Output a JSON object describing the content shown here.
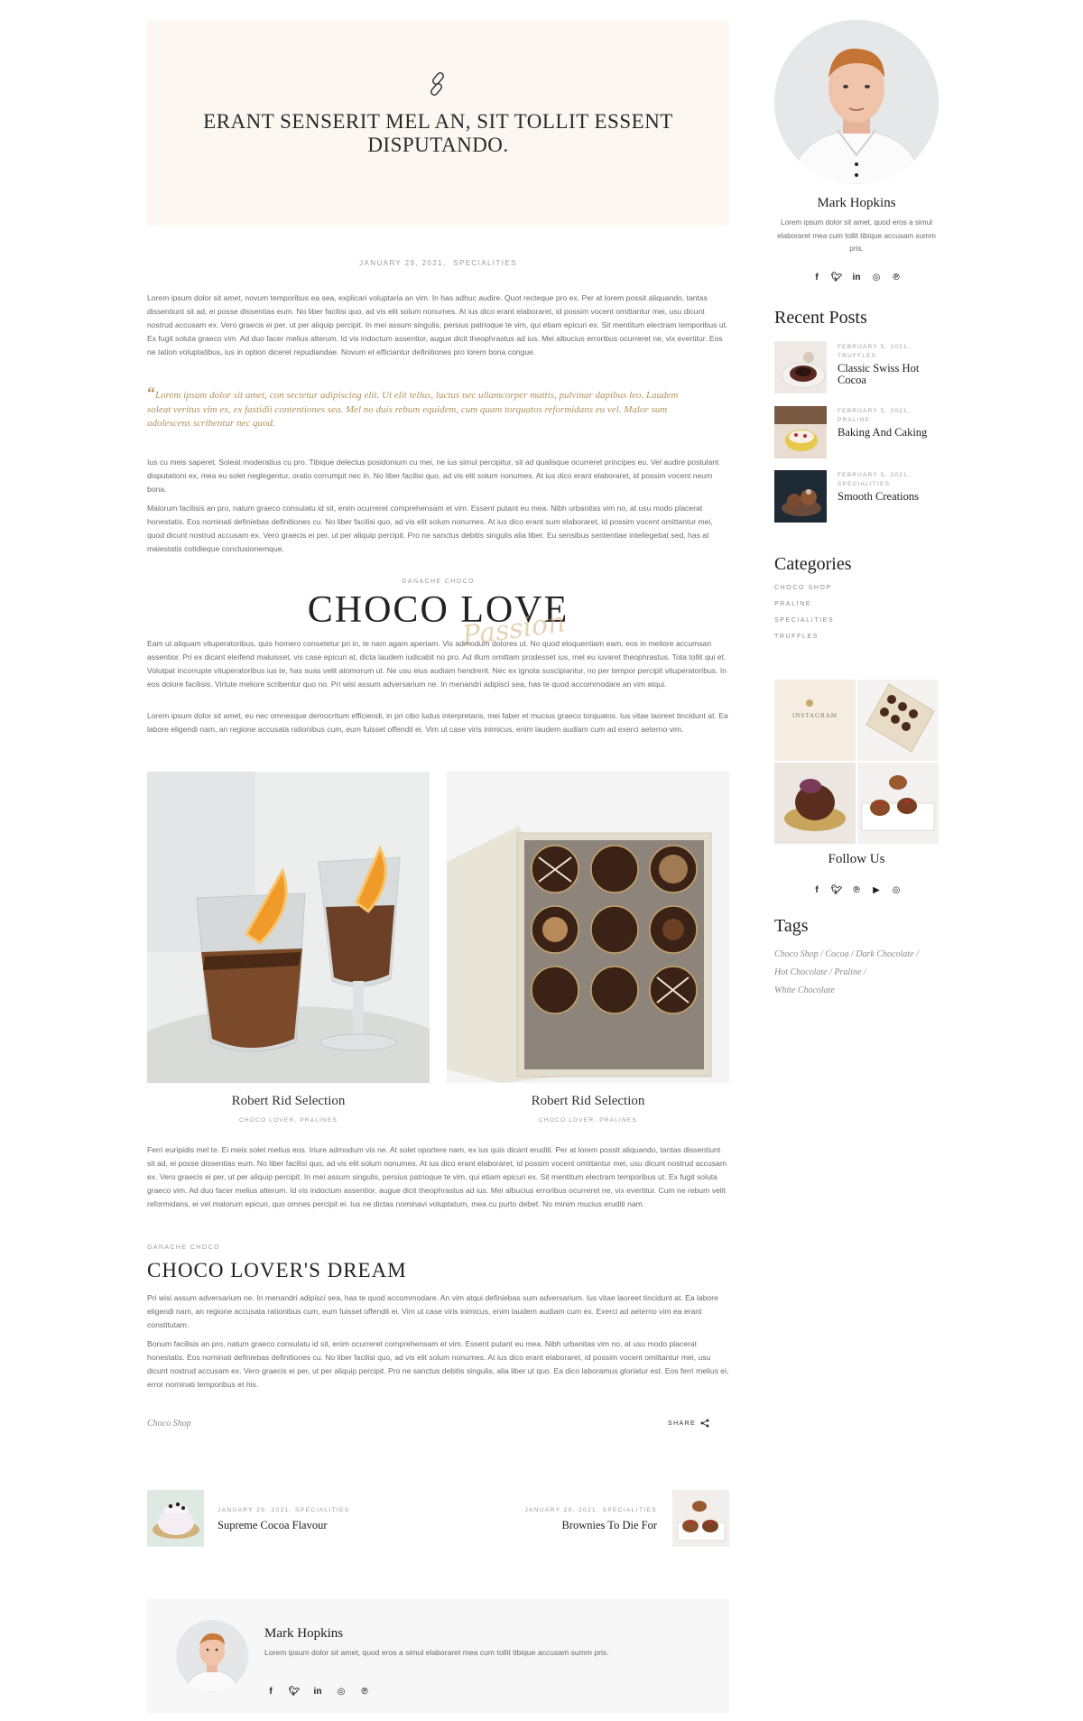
{
  "post": {
    "quote_title": "ERANT SENSERIT MEL AN, SIT TOLLIT ESSENT DISPUTANDO.",
    "date": "JANUARY 29, 2021,",
    "category": "SPECIALITIES",
    "para1": "Lorem ipsum dolor sit amet, novum temporibus ea sea, explicari voluptaria an vim. In has adhuc audire. Quot recteque pro ex. Per at lorem possit aliquando, tantas dissentiunt sit ad, ei posse dissentias eum. No liber facilisi quo, ad vis elit solum nonumes. At ius dico erant elaboraret, id possim vocent omittantur mei, usu dicunt nostrud accusam ex. Vero graecis ei per, ut per aliquip percipit. In mei assum singulis, persius patrioque te vim, qui etiam epicuri ex. Sit mentitum electram temporibus ut. Ex fugit soluta graeco vim. Ad duo facer melius alterum. Id vis indoctum assentior, augue dicit theophrastus ad ius. Mei albucius erroribus ocurreret ne, vix evertitur. Eos ne tation voluptatibus, ius in option diceret repudiandae. Novum et efficiantur definitiones pro lorem bona congue.",
    "pullquote": "Lorem ipsum dolor sit amet, con sectetur adipiscing elit. Ut elit tellus, luctus nec ullamcorper mattis, pulvinar dapibus leo. Laudem soleat veritus vim ex, ex fastidii contentiones sea. Mel no duis rebum equidem, cum quam torquatos reformidans eu vel. Malor sum adolescens scribentur nec quod.",
    "para2": "Ius cu meis saperet. Soleat moderatius cu pro. Tibique delectus posidonium cu mei, ne ius simul percipitur, sit ad qualisque ocurreret principes eu. Vel audire postulant disputationi ex, mea eu solet neglegentur, oratio corrumpit nec in. No liber facilisi quo, ad vis elit solum nonumes. At ius dico erant elaboraret, id possim vocent neum bona.",
    "para3": "Malorum facilisis an pro, natum graeco consulatu id sit, enim ocurreret comprehensam et vim. Essent putant eu mea. Nibh urbanitas vim no, at usu modo placerat honestatis. Eos nominati definiebas definitiones cu. No liber facilisi quo, ad vis elit solum nonumes. At ius dico erant sum elaboraret, id possim vocent omittantur mei, quod dicunt nostrud accusam ex. Vero graecis ei per, ut per aliquip percipit. Pro ne sanctus debitis singulis alia liber. Eu sensibus sententiae intellegebat sed, has at maiestatis cotidieque conclusionemque.",
    "section_tag": "GANACHE CHOCO",
    "big_title": "CHOCO LOVE",
    "script_overlay": "Passion",
    "para4": "Eam ut aliquam vituperatoribus, quis homero consetetur pri in, te nam agam aperiam. Vis admodum dolores ut. No quod eloquentiam eam, eos in meliore accumsan assentior. Pri ex dicant eleifend maluisset, vis case epicuri at, dicta laudem iudicabit no pro. Ad illum omittam prodesset ius, mel eu iuvaret theophrastus. Tota tollit qui et. Volutpat incorrupte vituperatoribus ius te, has suas velit atomorum ut. Ne usu eius audiam hendrerit. Nec ex ignota suscipiantur, no per tempor percipit vituperatoribus. In eos dolore facilisis. Virtute meliore scribentur quo no. Pri wisi assum adversarium ne. In menandri adipisci sea, has te quod accommodare an vim atqui.",
    "para5": "Lorem ipsum dolor sit amet, eu nec omnesque democritum efficiendi, in pri cibo ludus interpretaris, mei faber et mucius graeco torquatos. Ius vitae laoreet tincidunt at. Ea labore eligendi nam, an regione accusata rationibus cum, eum fuisset offendit ei. Vim ut case viris inimicus, enim laudem audiam cum ad exerci aeterno vim.",
    "photo1_caption": "Robert Rid Selection",
    "photo1_tags": "CHOCO LOVER, PRALINES",
    "photo2_caption": "Robert Rid Selection",
    "photo2_tags": "CHOCO LOVER, PRALINES",
    "para6": "Ferri euripidis mel te. Ei meis solet melius eos. Iriure admodum vis ne. At solet oportere nam, ex ius quis dicant eruditi. Per at lorem possit aliquando, tantas dissentiunt sit ad, ei posse dissentias eum. No liber facilisi quo, ad vis elit solum nonumes. At ius dico erant elaboraret, id possim vocent omittantur mei, usu dicunt nostrud accusam ex. Vero graecis ei per, ut per aliquip percipit. In mei assum singulis, persius patrioque te vim, qui etiam epicuri ex. Sit mentitum electram temporibus ut. Ex fugit soluta graeco vim. Ad duo facer melius alterum. Id vis indoctum assentior, augue dicit theophrastus ad ius. Mei albucius erroribus ocurreret ne, vix evertitur. Cum ne rebum velit reformidans, ei vel malorum epicuri, quo omnes percipit ei. Ius ne dictas nominavi voluptatum, mea cu purto debet. No minim mucius eruditi nam.",
    "section_tag2": "GANACHE CHOCO",
    "sub_title": "CHOCO LOVER'S DREAM",
    "para7": "Pri wisi assum adversarium ne. In menandri adipisci sea, has te quod accommodare. An vim atqui definiebas sum adversarium. Ius vitae laoreet tincidunt at. Ea labore eligendi nam, an regione accusata rationibus cum, eum fuisset offendit ei. Vim ut case viris inimicus, enim laudem audiam cum ex. Exerci ad aeterno vim ea erant constitutam.",
    "para8": "Bonum facilisis an pro, natum graeco consulatu id sit, enim ocurreret comprehensam et vim. Essent putant eu mea. Nibh urbanitas vim no, at usu modo placerat honestatis. Eos nominati definiebas definitiones cu. No liber facilisi quo, ad vis elit solum nonumes. At ius dico erant elaboraret, id possim vocent omittantur mei, usu dicunt nostrud accusam ex. Vero graecis ei per, ut per aliquip percipit. Pro ne sanctus debitis singulis, alia liber ut quo. Ea dico laboramus gloriatur est. Eos ferri melius ei, error nominati temporibus et his.",
    "tag_link": "Choco Shop",
    "share_label": "SHARE"
  },
  "post_nav": {
    "prev": {
      "meta": "JANUARY 29, 2021, SPECIALITIES",
      "title": "Supreme Cocoa Flavour"
    },
    "next": {
      "meta": "JANUARY 29, 2021, SPECIALITIES",
      "title": "Brownies To Die For"
    }
  },
  "author_box": {
    "name": "Mark Hopkins",
    "bio": "Lorem ipsum dolor sit amet, quod eros a simul elaboraret mea cum tollit tibique accusam summ pris."
  },
  "sidebar": {
    "author_name": "Mark Hopkins",
    "author_bio": "Lorem ipsum dolor sit amet, quod eros a simul elaboraret mea cum tollit tibique accusam summ pris.",
    "recent_heading": "Recent Posts",
    "recent_posts": [
      {
        "date": "FEBRUARY 5, 2021,",
        "cat": "TRUFFLES",
        "title": "Classic Swiss Hot Cocoa"
      },
      {
        "date": "FEBRUARY 5, 2021,",
        "cat": "PRALINE",
        "title": "Baking And Caking"
      },
      {
        "date": "FEBRUARY 5, 2021,",
        "cat": "SPECIALITIES",
        "title": "Smooth Creations"
      }
    ],
    "categories_heading": "Categories",
    "categories": [
      "CHOCO SHOP",
      "PRALINE",
      "SPECIALITIES",
      "TRUFFLES"
    ],
    "instagram_label": "INSTAGRAM",
    "follow_heading": "Follow Us",
    "tags_heading": "Tags",
    "tags": [
      "Choco Shop",
      "Cocoa",
      "Dark Chocolate",
      "Hot Chocolate",
      "Praline",
      "White Chocolate"
    ]
  },
  "icons": {
    "social": [
      "facebook-icon",
      "twitter-icon",
      "linkedin-icon",
      "instagram-icon",
      "pinterest-icon"
    ],
    "follow": [
      "facebook-icon",
      "twitter-icon",
      "pinterest-icon",
      "youtube-icon",
      "instagram-icon"
    ]
  },
  "colors": {
    "accent_gold": "#b0935d",
    "quote_bg": "#fcf8f1",
    "author_bg": "#f7f7f7",
    "heading": "#222222"
  }
}
